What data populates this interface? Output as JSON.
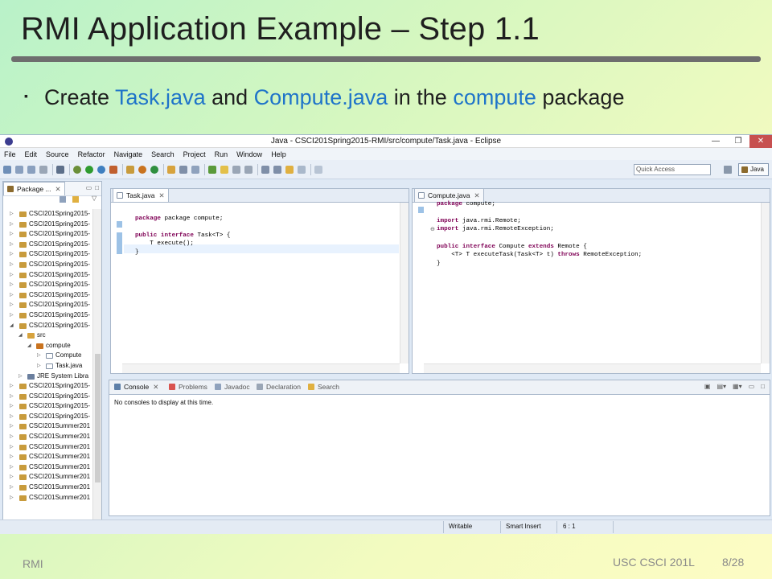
{
  "slide": {
    "title": "RMI Application Example – Step 1.1",
    "bullet": {
      "part1": "Create ",
      "file1": "Task.java",
      "part2": " and ",
      "file2": "Compute.java",
      "part3": " in the ",
      "pkg": "compute",
      "part4": " package"
    },
    "footer_left": "RMI",
    "footer_course": "USC CSCI 201L",
    "footer_page": "8/28"
  },
  "window": {
    "title": "Java - CSCI201Spring2015-RMI/src/compute/Task.java - Eclipse",
    "buttons": [
      "—",
      "❐",
      "✕"
    ]
  },
  "menu": [
    "File",
    "Edit",
    "Source",
    "Refactor",
    "Navigate",
    "Search",
    "Project",
    "Run",
    "Window",
    "Help"
  ],
  "toolbar": {
    "quick_access": "Quick Access",
    "perspective": "Java"
  },
  "package_explorer": {
    "tab_label": "Package ...",
    "items": [
      "CSCI201Spring2015-",
      "CSCI201Spring2015-",
      "CSCI201Spring2015-",
      "CSCI201Spring2015-",
      "CSCI201Spring2015-",
      "CSCI201Spring2015-",
      "CSCI201Spring2015-",
      "CSCI201Spring2015-",
      "CSCI201Spring2015-",
      "CSCI201Spring2015-",
      "CSCI201Spring2015-",
      "CSCI201Spring2015-",
      "src",
      "compute",
      "Compute",
      "Task.java",
      "JRE System Libra",
      "CSCI201Spring2015-",
      "CSCI201Spring2015-",
      "CSCI201Spring2015-",
      "CSCI201Spring2015-",
      "CSCI201Summer201",
      "CSCI201Summer201",
      "CSCI201Summer201",
      "CSCI201Summer201",
      "CSCI201Summer201",
      "CSCI201Summer201",
      "CSCI201Summer201",
      "CSCI201Summer201"
    ]
  },
  "editor_task": {
    "tab_label": "Task.java",
    "lines": [
      [
        "package compute;"
      ],
      [
        ""
      ],
      [
        "public interface Task<T> {"
      ],
      [
        "    T execute();"
      ],
      [
        "}"
      ]
    ]
  },
  "editor_compute": {
    "tab_label": "Compute.java",
    "lines": [
      "package compute;",
      "",
      "import java.rmi.Remote;",
      "import java.rmi.RemoteException;",
      "",
      "public interface Compute extends Remote {",
      "    <T> T executeTask(Task<T> t) throws RemoteException;",
      "}"
    ]
  },
  "console": {
    "tabs": [
      "Console",
      "Problems",
      "Javadoc",
      "Declaration",
      "Search"
    ],
    "message": "No consoles to display at this time."
  },
  "status": {
    "writable": "Writable",
    "insert_mode": "Smart Insert",
    "position": "6 : 1"
  },
  "colors": {
    "highlight": "#1f74c9",
    "keyword": "#7f0055"
  }
}
